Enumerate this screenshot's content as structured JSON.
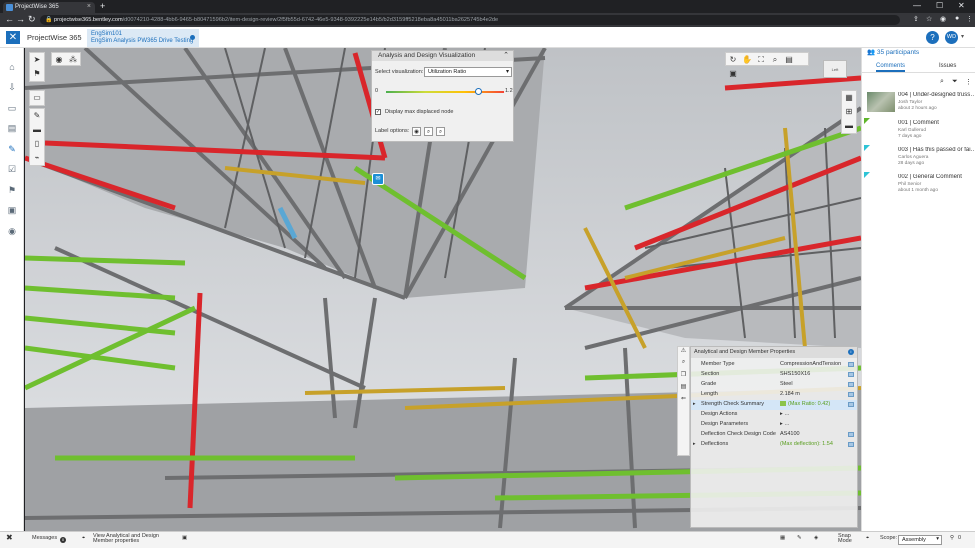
{
  "browser": {
    "tab_title": "ProjectWise 365",
    "tab_close": "×",
    "new_tab": "+",
    "url_host": "projectwise365.bentley.com",
    "url_path": "/d0074210-4288-4bb6-9465-b80471596b2/item-design-review/2f5fb55d-6742-46e5-9348-9392225e14b5/b2d3159ff5218eba8a45011ba2625745b4e2de",
    "back": "←",
    "forward": "→",
    "reload": "↻",
    "lock": "🔒",
    "min": "—",
    "max": "☐",
    "close": "✕"
  },
  "app": {
    "title": "ProjectWise 365",
    "project_line1": "EngSim101",
    "project_line2": "EngSim Analysis PW365 Drive Testing",
    "help": "?",
    "avatar_initials": "WD"
  },
  "analysis_panel": {
    "title": "Analysis and Design Visualization",
    "select_label": "Select visualization:",
    "select_value": "Utilization Ratio",
    "slider_min": "0",
    "slider_max": "1.2",
    "slider_value": 0.95,
    "checkbox_label": "Display max displaced node",
    "checkbox_checked": "✓",
    "label_options": "Label options:"
  },
  "viewport": {
    "cube_label": "Left",
    "marker": "✉"
  },
  "member_properties": {
    "title": "Analytical and Design Member Properties",
    "rows": [
      {
        "key": "Member Type",
        "value": "CompressionAndTension"
      },
      {
        "key": "Section",
        "value": "SHS150X16"
      },
      {
        "key": "Grade",
        "value": "Steel"
      },
      {
        "key": "Length",
        "value": "2.184 m"
      },
      {
        "key": "Strength Check Summary",
        "value": "(Max Ratio: 0.42)"
      },
      {
        "key": "Design Actions",
        "value": ""
      },
      {
        "key": "Design Parameters",
        "value": ""
      },
      {
        "key": "Deflection Check Design Code",
        "value": "AS4100"
      },
      {
        "key": "Deflections",
        "value": "(Max deflection): 1.54"
      }
    ]
  },
  "right_panel": {
    "participants": "35 participants",
    "tab_comments": "Comments",
    "tab_issues": "Issues",
    "comments": [
      {
        "title": "004 | Under-designed truss…",
        "author": "Josh Taylor",
        "time": "about 2 hours ago"
      },
      {
        "title": "001 | Comment",
        "author": "Karl Gullerud",
        "time": "7 days ago"
      },
      {
        "title": "003 | Has this passed or fai…",
        "author": "Carlos Aguera",
        "time": "28 days ago"
      },
      {
        "title": "002 | General Comment",
        "author": "Phil Senior",
        "time": "about 1 month ago"
      }
    ]
  },
  "bottom_bar": {
    "messages": "Messages",
    "messages_count": "0",
    "view_props": "View Analytical and Design Member properties",
    "snap_mode": "Snap Mode",
    "scope_label": "Scope:",
    "scope_value": "Assembly",
    "count": "0"
  },
  "colors": {
    "accent": "#1c6fbc",
    "high_util": "#d9262b",
    "mid_util": "#c7a12a",
    "low_util": "#6fbf2f",
    "neutral_member": "#6d6e70"
  }
}
